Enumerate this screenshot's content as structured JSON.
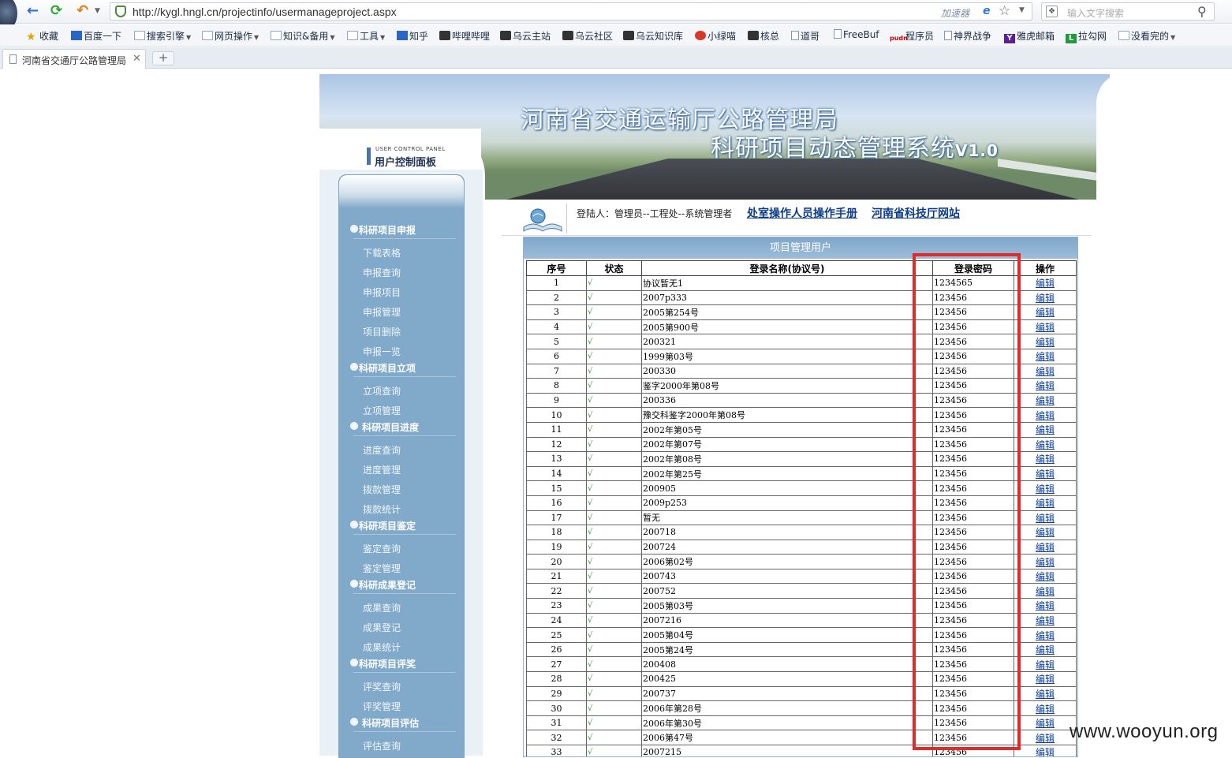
{
  "browser": {
    "url": "http://kygl.hngl.cn/projectinfo/usermanageproject.aspx",
    "accelerator_label": "加速器",
    "search_placeholder": "输入文字搜索",
    "tab_title": "河南省交通厅公路管理局",
    "new_tab_label": "+",
    "bookmarks": [
      {
        "label": "收藏",
        "icon": "star-icon"
      },
      {
        "label": "百度一下",
        "icon": "baidu-icon"
      },
      {
        "label": "搜索引擎",
        "icon": "folder-icon",
        "menu": true
      },
      {
        "label": "网页操作",
        "icon": "folder-icon",
        "menu": true
      },
      {
        "label": "知识&备用",
        "icon": "folder-icon",
        "menu": true
      },
      {
        "label": "工具",
        "icon": "folder-icon",
        "menu": true
      },
      {
        "label": "知乎",
        "icon": "zhihu-icon"
      },
      {
        "label": "哔哩哔哩",
        "icon": "bilibili-icon"
      },
      {
        "label": "乌云主站",
        "icon": "wooyun-icon"
      },
      {
        "label": "乌云社区",
        "icon": "wooyun-icon"
      },
      {
        "label": "乌云知识库",
        "icon": "wooyun-icon"
      },
      {
        "label": "小绿喵",
        "icon": "weibo-icon"
      },
      {
        "label": "核总",
        "icon": "image-icon"
      },
      {
        "label": "道哥",
        "icon": "page-icon"
      },
      {
        "label": "FreeBuf",
        "icon": "page-icon"
      },
      {
        "label": "程序员",
        "icon": "pudn-icon"
      },
      {
        "label": "神界战争",
        "icon": "page-icon"
      },
      {
        "label": "雅虎邮箱",
        "icon": "yahoo-icon"
      },
      {
        "label": "拉勾网",
        "icon": "lagou-icon"
      },
      {
        "label": "没看完的",
        "icon": "folder-icon",
        "menu": true
      }
    ]
  },
  "banner": {
    "title_line1": "河南省交通运输厅公路管理局",
    "title_line2": "科研项目动态管理系统",
    "version": "V1.0"
  },
  "panel": {
    "en_label": "USER CONTROL PANEL",
    "cn_label": "用户控制面板"
  },
  "sidebar": {
    "sections": [
      {
        "title": "科研项目申报",
        "items": [
          "下载表格",
          "申报查询",
          "申报项目",
          "申报管理",
          "项目删除",
          "申报一览"
        ]
      },
      {
        "title": "科研项目立项",
        "items": [
          "立项查询",
          "立项管理"
        ]
      },
      {
        "title": " 科研项目进度",
        "items": [
          "进度查询",
          "进度管理",
          "拨款管理",
          "拨款统计"
        ]
      },
      {
        "title": "科研项目鉴定",
        "items": [
          "鉴定查询",
          "鉴定管理"
        ]
      },
      {
        "title": "科研成果登记",
        "items": [
          "成果查询",
          "成果登记",
          "成果统计"
        ]
      },
      {
        "title": "科研项目评奖",
        "items": [
          "评奖查询",
          "评奖管理"
        ]
      },
      {
        "title": " 科研项目评估",
        "items": [
          "评估查询"
        ]
      }
    ]
  },
  "header": {
    "login_info": "登陆人：管理员--工程处--系统管理者",
    "link_manual": "处室操作人员操作手册",
    "link_site": "河南省科技厅网站"
  },
  "grid": {
    "caption": "项目管理用户",
    "columns": [
      "序号",
      "状态",
      "登录名称(协议号)",
      "登录密码",
      "操作"
    ],
    "rows": [
      [
        "1",
        "√",
        "协议暂无1",
        "1234565",
        "编辑"
      ],
      [
        "2",
        "√",
        "2007p333",
        "123456",
        "编辑"
      ],
      [
        "3",
        "√",
        "2005第254号",
        "123456",
        "编辑"
      ],
      [
        "4",
        "√",
        "2005第900号",
        "123456",
        "编辑"
      ],
      [
        "5",
        "√",
        "200321",
        "123456",
        "编辑"
      ],
      [
        "6",
        "√",
        "1999第03号",
        "123456",
        "编辑"
      ],
      [
        "7",
        "√",
        "200330",
        "123456",
        "编辑"
      ],
      [
        "8",
        "√",
        "鉴字2000年第08号",
        "123456",
        "编辑"
      ],
      [
        "9",
        "√",
        "200336",
        "123456",
        "编辑"
      ],
      [
        "10",
        "√",
        "豫交科鉴字2000年第08号",
        "123456",
        "编辑"
      ],
      [
        "11",
        "√",
        "2002年第05号",
        "123456",
        "编辑"
      ],
      [
        "12",
        "√",
        "2002年第07号",
        "123456",
        "编辑"
      ],
      [
        "13",
        "√",
        "2002年第08号",
        "123456",
        "编辑"
      ],
      [
        "14",
        "√",
        "2002年第25号",
        "123456",
        "编辑"
      ],
      [
        "15",
        "√",
        "200905",
        "123456",
        "编辑"
      ],
      [
        "16",
        "√",
        "2009p253",
        "123456",
        "编辑"
      ],
      [
        "17",
        "√",
        "暂无",
        "123456",
        "编辑"
      ],
      [
        "18",
        "√",
        "200718",
        "123456",
        "编辑"
      ],
      [
        "19",
        "√",
        "200724",
        "123456",
        "编辑"
      ],
      [
        "20",
        "√",
        "2006第02号",
        "123456",
        "编辑"
      ],
      [
        "21",
        "√",
        "200743",
        "123456",
        "编辑"
      ],
      [
        "22",
        "√",
        "200752",
        "123456",
        "编辑"
      ],
      [
        "23",
        "√",
        "2005第03号",
        "123456",
        "编辑"
      ],
      [
        "24",
        "√",
        "2007216",
        "123456",
        "编辑"
      ],
      [
        "25",
        "√",
        "2005第04号",
        "123456",
        "编辑"
      ],
      [
        "26",
        "√",
        "2005第24号",
        "123456",
        "编辑"
      ],
      [
        "27",
        "√",
        "200408",
        "123456",
        "编辑"
      ],
      [
        "28",
        "√",
        "200425",
        "123456",
        "编辑"
      ],
      [
        "29",
        "√",
        "200737",
        "123456",
        "编辑"
      ],
      [
        "30",
        "√",
        "2006年第28号",
        "123456",
        "编辑"
      ],
      [
        "31",
        "√",
        "2006年第30号",
        "123456",
        "编辑"
      ],
      [
        "32",
        "√",
        "2006第47号",
        "123456",
        "编辑"
      ],
      [
        "33",
        "√",
        "2007215",
        "123456",
        "编辑"
      ]
    ]
  },
  "watermark": "www.wooyun.org",
  "colors": {
    "sidebar_bg": "#81a9c9",
    "link": "#0b3c8c",
    "highlight": "#e32a2a",
    "check": "#2a9b2a"
  }
}
